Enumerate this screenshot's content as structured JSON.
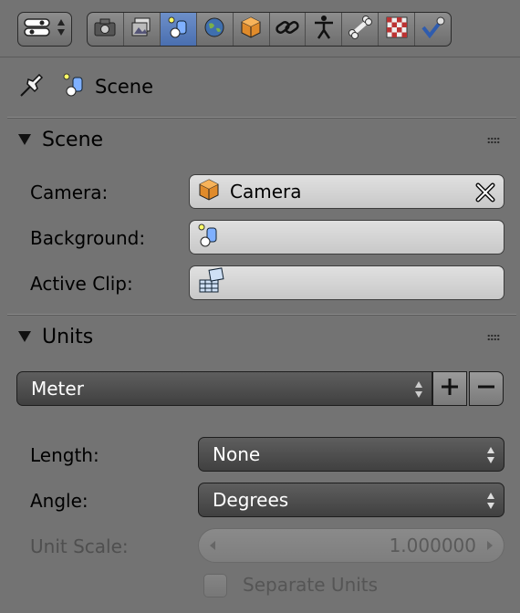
{
  "toolbar": {
    "editor_type_icon": "properties-editor-icon",
    "context_tabs": [
      {
        "name": "render",
        "icon": "camera-icon",
        "active": false
      },
      {
        "name": "render-layers",
        "icon": "layers-icon",
        "active": false
      },
      {
        "name": "scene",
        "icon": "scene-icon",
        "active": true
      },
      {
        "name": "world",
        "icon": "world-icon",
        "active": false
      },
      {
        "name": "object",
        "icon": "cube-icon",
        "active": false
      },
      {
        "name": "constraints",
        "icon": "link-icon",
        "active": false
      },
      {
        "name": "modifiers",
        "icon": "figure-icon",
        "active": false
      },
      {
        "name": "data",
        "icon": "bone-icon",
        "active": false
      },
      {
        "name": "material",
        "icon": "checker-icon",
        "active": false
      },
      {
        "name": "texture",
        "icon": "check-icon",
        "active": false
      }
    ],
    "active_color": "#5680c2"
  },
  "breadcrumb": {
    "pin_icon": "pin-icon",
    "scene_icon": "scene-icon",
    "label": "Scene"
  },
  "scene_panel": {
    "title": "Scene",
    "camera_label": "Camera:",
    "camera_value": "Camera",
    "camera_icon": "cube-icon",
    "background_label": "Background:",
    "background_value": "",
    "background_icon": "scene-icon",
    "active_clip_label": "Active Clip:",
    "active_clip_value": "",
    "active_clip_icon": "movie-clip-icon"
  },
  "units_panel": {
    "title": "Units",
    "preset_value": "Meter",
    "length_label": "Length:",
    "length_value": "None",
    "angle_label": "Angle:",
    "angle_value": "Degrees",
    "unit_scale_label": "Unit Scale:",
    "unit_scale_value": "1.000000",
    "separate_units_label": "Separate Units",
    "separate_units_checked": false
  }
}
